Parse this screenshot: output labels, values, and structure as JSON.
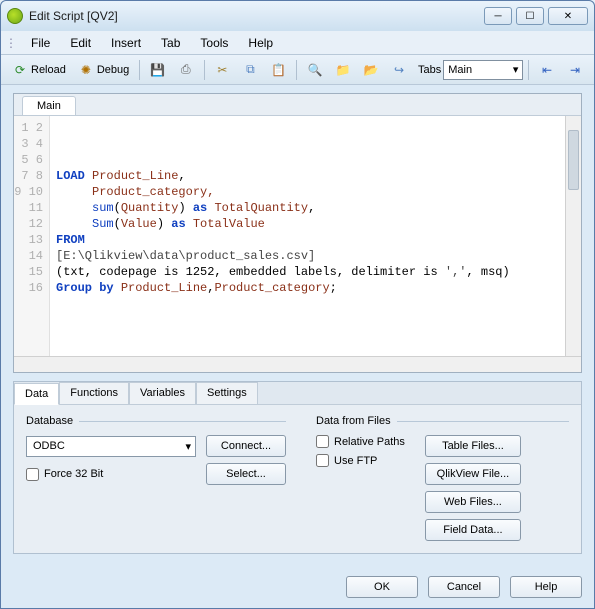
{
  "window": {
    "title": "Edit Script [QV2]"
  },
  "menu": {
    "file": "File",
    "edit": "Edit",
    "insert": "Insert",
    "tab": "Tab",
    "tools": "Tools",
    "help": "Help"
  },
  "toolbar": {
    "reload": "Reload",
    "debug": "Debug",
    "tabs_label": "Tabs",
    "tabs_value": "Main"
  },
  "editor": {
    "tab_label": "Main",
    "line_count": 16,
    "code": {
      "l4a": "LOAD",
      "l4b": " Product_Line",
      "l4c": ",",
      "l5": "     Product_category,",
      "l6a": "     ",
      "l6b": "sum",
      "l6c": "(",
      "l6d": "Quantity",
      "l6e": ") ",
      "l6f": "as",
      "l6g": " TotalQuantity",
      "l6h": ",",
      "l7a": "     ",
      "l7b": "Sum",
      "l7c": "(",
      "l7d": "Value",
      "l7e": ") ",
      "l7f": "as",
      "l7g": " TotalValue",
      "l8": "FROM",
      "l9": "[E:\\Qlikview\\data\\product_sales.csv]",
      "l10a": "(txt, codepage is 1252, embedded labels, delimiter is ",
      "l10b": "','",
      "l10c": ", msq)",
      "l11a": "Group",
      "l11b": " ",
      "l11c": "by",
      "l11d": " Product_Line",
      "l11e": ",",
      "l11f": "Product_category",
      "l11g": ";"
    }
  },
  "panel": {
    "tabs": {
      "data": "Data",
      "functions": "Functions",
      "variables": "Variables",
      "settings": "Settings"
    },
    "database_group": "Database",
    "files_group": "Data from Files",
    "odbc": "ODBC",
    "connect": "Connect...",
    "select": "Select...",
    "force32": "Force 32 Bit",
    "relpaths": "Relative Paths",
    "useftp": "Use FTP",
    "tablefiles": "Table Files...",
    "qvfile": "QlikView File...",
    "webfiles": "Web Files...",
    "fielddata": "Field Data..."
  },
  "footer": {
    "ok": "OK",
    "cancel": "Cancel",
    "help": "Help"
  }
}
